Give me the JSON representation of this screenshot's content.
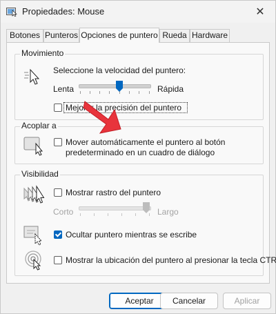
{
  "window": {
    "title": "Propiedades: Mouse",
    "close_symbol": "✕"
  },
  "tabs": [
    {
      "label": "Botones"
    },
    {
      "label": "Punteros"
    },
    {
      "label": "Opciones de puntero",
      "active": true
    },
    {
      "label": "Rueda"
    },
    {
      "label": "Hardware"
    }
  ],
  "movimiento": {
    "legend": "Movimiento",
    "speed_label": "Seleccione la velocidad del puntero:",
    "slow": "Lenta",
    "fast": "Rápida",
    "speed_value": 0.5,
    "precision_label": "Mejorar la precisión del puntero",
    "precision_checked": false
  },
  "acoplar": {
    "legend": "Acoplar a",
    "snap_label_line1": "Mover automáticamente el puntero al botón",
    "snap_label_line2": "predeterminado en un cuadro de diálogo",
    "snap_checked": false
  },
  "visibilidad": {
    "legend": "Visibilidad",
    "trail_label": "Mostrar rastro del puntero",
    "trail_checked": false,
    "short": "Corto",
    "long": "Largo",
    "trail_value": 1.0,
    "hide_label": "Ocultar puntero mientras se escribe",
    "hide_checked": true,
    "ctrl_label": "Mostrar la ubicación del puntero al presionar la tecla CTRL",
    "ctrl_checked": false
  },
  "buttons": {
    "accept": "Aceptar",
    "cancel": "Cancelar",
    "apply": "Aplicar"
  },
  "colors": {
    "accent": "#0067c0",
    "arrow": "#e8343c"
  }
}
